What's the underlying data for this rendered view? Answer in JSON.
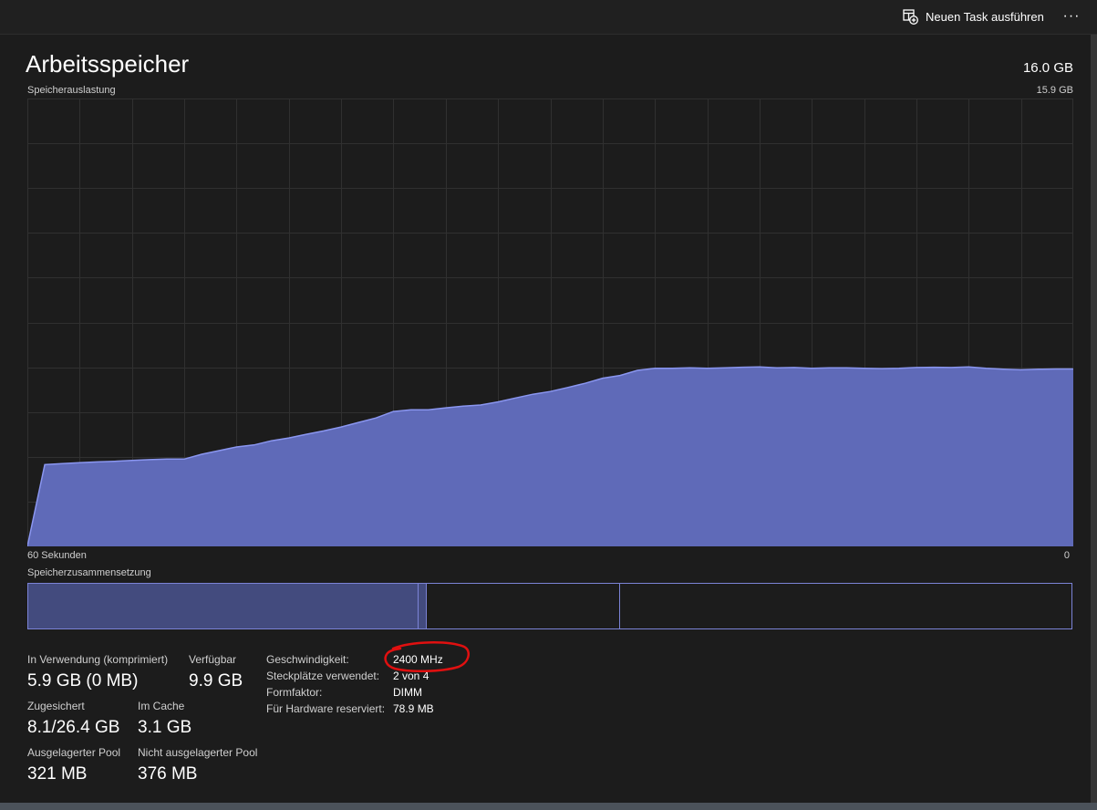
{
  "toolbar": {
    "new_task_label": "Neuen Task ausführen",
    "new_task_icon": "new-task-icon",
    "more_label": "···"
  },
  "header": {
    "title": "Arbeitsspeicher",
    "total": "16.0 GB"
  },
  "usage_chart": {
    "label": "Speicherauslastung",
    "max_label": "15.9 GB",
    "x_left_label": "60 Sekunden",
    "x_right_label": "0",
    "fill_color": "#5f6ab8",
    "line_color": "#8a96f0",
    "grid_color": "#303030"
  },
  "chart_data": {
    "type": "area",
    "xlabel_left": "60 Sekunden",
    "xlabel_right": "0",
    "ylim": [
      0,
      15.9
    ],
    "x": [
      60,
      59,
      58,
      57,
      56,
      55,
      54,
      53,
      52,
      51,
      50,
      49,
      48,
      47,
      46,
      45,
      44,
      43,
      42,
      41,
      40,
      39,
      38,
      37,
      36,
      35,
      34,
      33,
      32,
      31,
      30,
      29,
      28,
      27,
      26,
      25,
      24,
      23,
      22,
      21,
      20,
      19,
      18,
      17,
      16,
      15,
      14,
      13,
      12,
      11,
      10,
      9,
      8,
      7,
      6,
      5,
      4,
      3,
      2,
      1,
      0
    ],
    "series": [
      {
        "values": [
          0.0,
          2.9,
          2.94,
          2.97,
          3.0,
          3.02,
          3.05,
          3.08,
          3.1,
          3.1,
          3.27,
          3.4,
          3.53,
          3.6,
          3.75,
          3.85,
          3.98,
          4.1,
          4.24,
          4.4,
          4.56,
          4.79,
          4.85,
          4.85,
          4.92,
          4.98,
          5.02,
          5.13,
          5.27,
          5.4,
          5.5,
          5.64,
          5.79,
          5.97,
          6.07,
          6.25,
          6.32,
          6.32,
          6.34,
          6.32,
          6.34,
          6.36,
          6.37,
          6.34,
          6.35,
          6.32,
          6.34,
          6.34,
          6.32,
          6.31,
          6.32,
          6.35,
          6.36,
          6.35,
          6.37,
          6.32,
          6.29,
          6.27,
          6.29,
          6.3,
          6.3
        ]
      }
    ],
    "grid": true
  },
  "composition": {
    "label": "Speicherzusammensetzung",
    "in_use_fraction": 0.3735,
    "modified_fraction": 0.0087,
    "standby_fraction": 0.1839,
    "in_use_color": "#434b7e",
    "border_color": "#7b83d6"
  },
  "stats": {
    "in_use_label": "In Verwendung (komprimiert)",
    "in_use_value": "5.9 GB (0 MB)",
    "available_label": "Verfügbar",
    "available_value": "9.9 GB",
    "committed_label": "Zugesichert",
    "committed_value": "8.1/26.4 GB",
    "cached_label": "Im Cache",
    "cached_value": "3.1 GB",
    "paged_label": "Ausgelagerter Pool",
    "paged_value": "321 MB",
    "nonpaged_label": "Nicht ausgelagerter Pool",
    "nonpaged_value": "376 MB"
  },
  "details": {
    "speed_label": "Geschwindigkeit:",
    "speed_value": "2400 MHz",
    "slots_label": "Steckplätze verwendet:",
    "slots_value": "2 von 4",
    "form_label": "Formfaktor:",
    "form_value": "DIMM",
    "reserved_label": "Für Hardware reserviert:",
    "reserved_value": "78.9 MB"
  },
  "annotation": {
    "highlight_color": "#e01010"
  }
}
